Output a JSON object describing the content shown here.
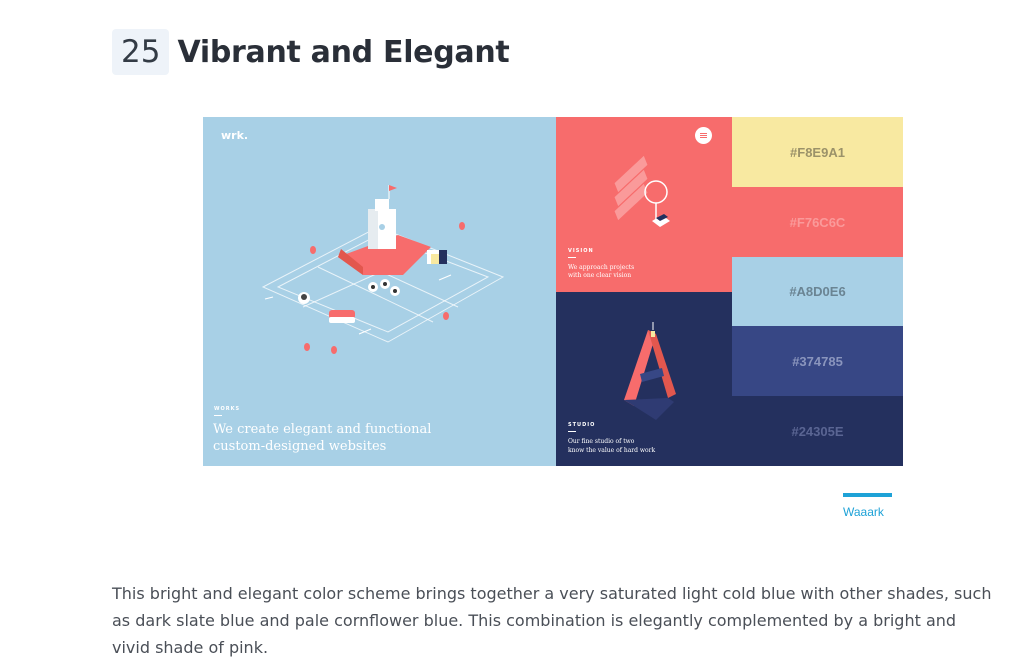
{
  "heading": {
    "number": "25",
    "title": "Vibrant and Elegant"
  },
  "showcase": {
    "logo": "wrk.",
    "works": {
      "caption": "WORKS",
      "line1": "We create elegant and functional",
      "line2": "custom-designed websites"
    },
    "vision": {
      "caption": "VISION",
      "line1": "We approach projects",
      "line2": "with one clear vision"
    },
    "studio": {
      "caption": "STUDIO",
      "line1": "Our fine studio of two",
      "line2": "know the value of hard work"
    }
  },
  "palette": [
    {
      "hex": "#F8E9A1",
      "color": "#f8e9a1",
      "text_color": "#9b9269"
    },
    {
      "hex": "#F76C6C",
      "color": "#f76c6c",
      "text_color": "#fa9a9a"
    },
    {
      "hex": "#A8D0E6",
      "color": "#a8d0e6",
      "text_color": "#6a8493"
    },
    {
      "hex": "#374785",
      "color": "#374785",
      "text_color": "#8a95bd"
    },
    {
      "hex": "#24305E",
      "color": "#24305e",
      "text_color": "#5a6593"
    }
  ],
  "credit": {
    "label": "Waaark",
    "color": "#1ea2d7"
  },
  "description": "This bright and elegant color scheme brings together a very saturated light cold blue with other shades, such as dark slate blue and pale cornflower blue. This combination is elegantly complemented by a bright and vivid shade of pink."
}
